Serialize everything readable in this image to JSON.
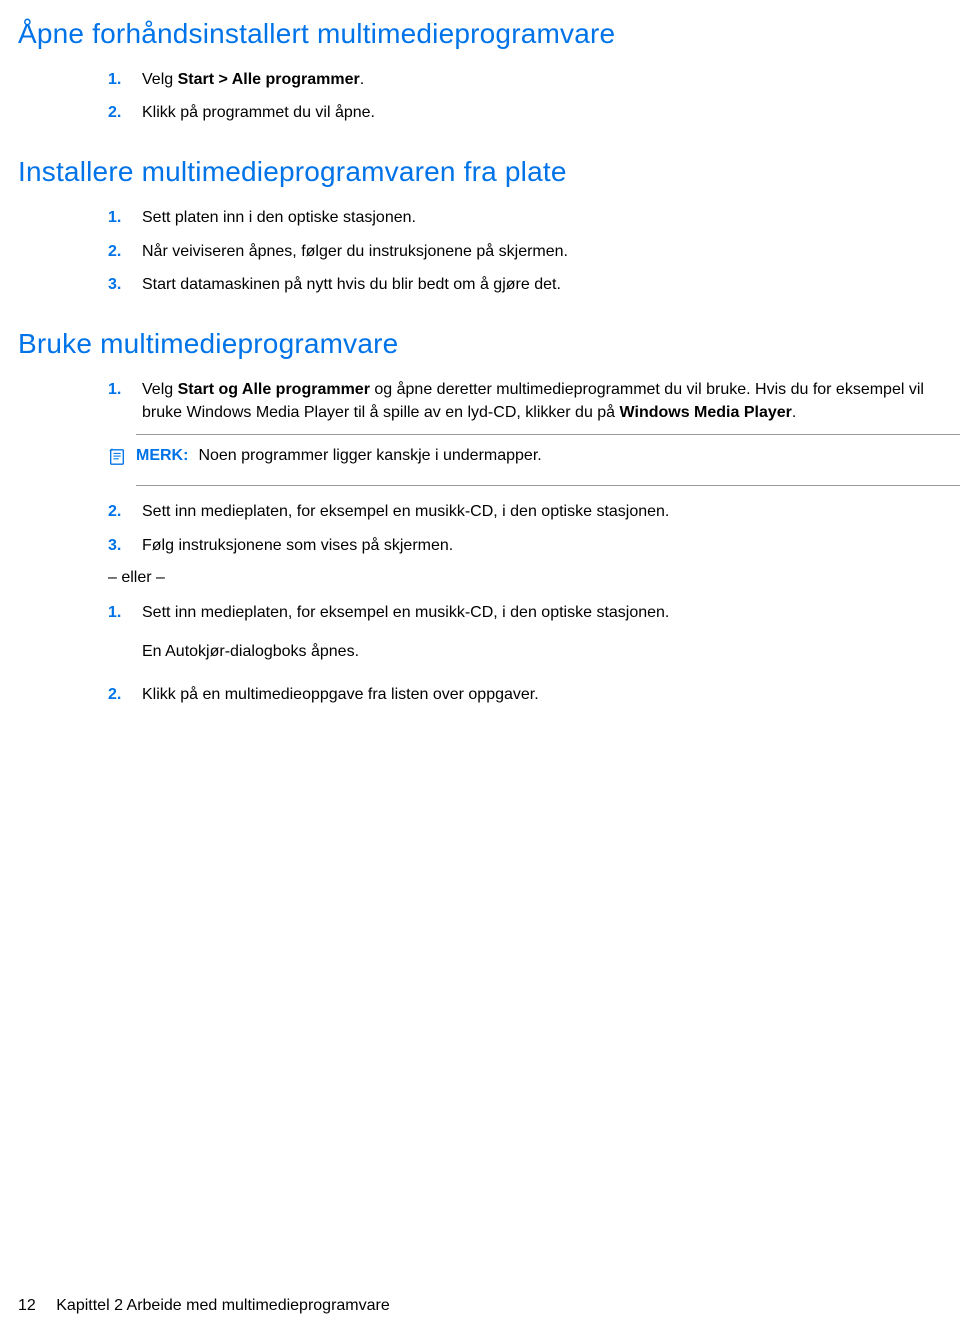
{
  "section1": {
    "heading": "Åpne forhåndsinstallert multimedieprogramvare",
    "steps": [
      {
        "n": "1.",
        "pre": "Velg ",
        "bold": "Start > Alle programmer",
        "post": "."
      },
      {
        "n": "2.",
        "pre": "Klikk på programmet du vil åpne.",
        "bold": "",
        "post": ""
      }
    ]
  },
  "section2": {
    "heading": "Installere multimedieprogramvaren fra plate",
    "steps": [
      {
        "n": "1.",
        "text": "Sett platen inn i den optiske stasjonen."
      },
      {
        "n": "2.",
        "text": "Når veiviseren åpnes, følger du instruksjonene på skjermen."
      },
      {
        "n": "3.",
        "text": "Start datamaskinen på nytt hvis du blir bedt om å gjøre det."
      }
    ]
  },
  "section3": {
    "heading": "Bruke multimedieprogramvare",
    "step1": {
      "n": "1.",
      "t1": "Velg ",
      "b1": "Start og Alle programmer",
      "t2": " og åpne deretter multimedieprogrammet du vil bruke. Hvis du for eksempel vil bruke Windows Media Player til å spille av en lyd-CD, klikker du på ",
      "b2": "Windows Media Player",
      "t3": "."
    },
    "note": {
      "label": "MERK:",
      "text": "Noen programmer ligger kanskje i undermapper."
    },
    "step2": {
      "n": "2.",
      "text": "Sett inn medieplaten, for eksempel en musikk-CD, i den optiske stasjonen."
    },
    "step3": {
      "n": "3.",
      "text": "Følg instruksjonene som vises på skjermen."
    },
    "connector": "– eller –",
    "alt1": {
      "n": "1.",
      "text": "Sett inn medieplaten, for eksempel en musikk-CD, i den optiske stasjonen.",
      "sub": "En Autokjør-dialogboks åpnes."
    },
    "alt2": {
      "n": "2.",
      "text": "Klikk på en multimedieoppgave fra listen over oppgaver."
    }
  },
  "footer": {
    "page": "12",
    "chapter": "Kapittel 2   Arbeide med multimedieprogramvare"
  }
}
